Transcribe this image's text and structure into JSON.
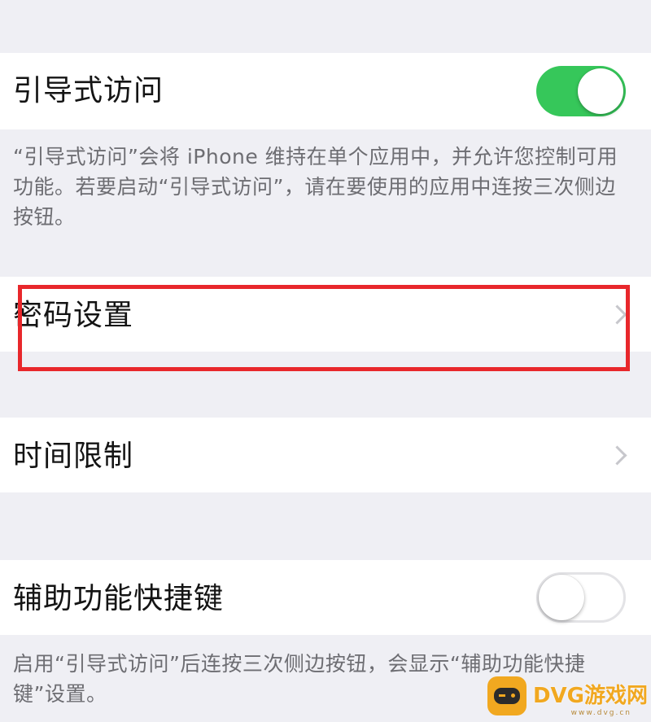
{
  "guided_access": {
    "label": "引导式访问",
    "toggle_state": "on",
    "footer": "“引导式访问”会将 iPhone 维持在单个应用中，并允许您控制可用功能。若要启动“引导式访问”，请在要使用的应用中连按三次侧边按钮。"
  },
  "passcode_settings": {
    "label": "密码设置",
    "chevron_icon": "chevron-right-icon"
  },
  "time_limits": {
    "label": "时间限制",
    "chevron_icon": "chevron-right-icon"
  },
  "accessibility_shortcut": {
    "label": "辅助功能快捷键",
    "toggle_state": "off",
    "footer": "启用“引导式访问”后连按三次侧边按钮，会显示“辅助功能快捷键”设置。"
  },
  "annotation": {
    "highlight_target": "passcode_settings",
    "color": "#e8272b"
  },
  "watermark": {
    "text": "DVG游戏网",
    "subtext": "www.dvg.cn",
    "icon": "gamepad-icon",
    "color": "#f1a820"
  },
  "colors": {
    "background": "#efeff4",
    "cell": "#ffffff",
    "toggle_on": "#36c75a",
    "footer_text": "#6d6d72",
    "chevron": "#c7c7cc"
  }
}
